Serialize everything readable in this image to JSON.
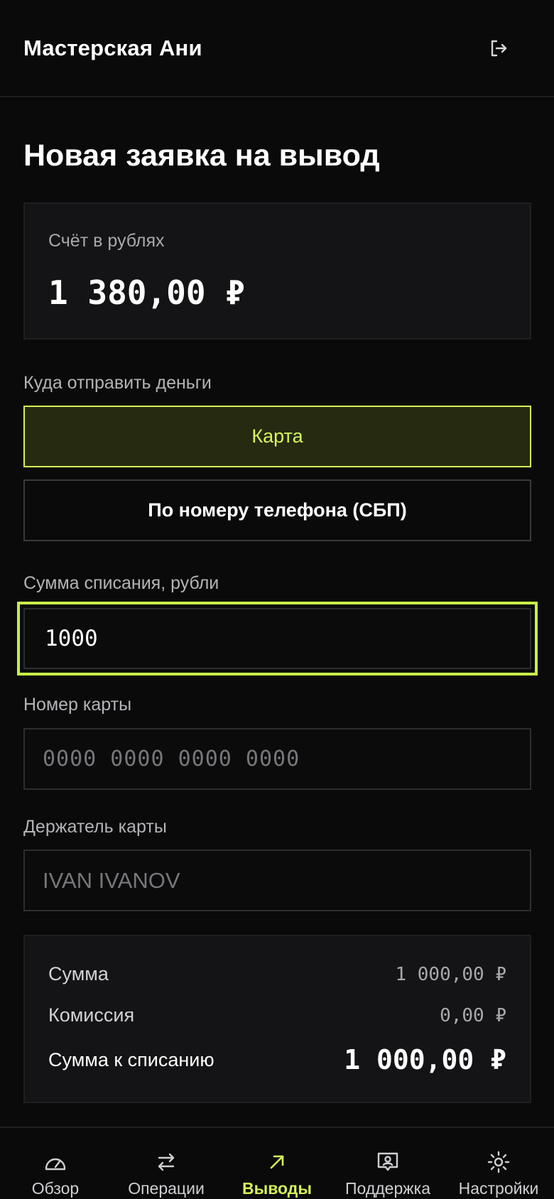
{
  "header": {
    "title": "Мастерская Ани",
    "logout_icon": "logout-icon"
  },
  "page": {
    "title": "Новая заявка на вывод"
  },
  "balance": {
    "label": "Счёт в рублях",
    "value": "1 380,00 ₽"
  },
  "destination": {
    "label": "Куда отправить деньги",
    "options": [
      {
        "label": "Карта",
        "selected": true
      },
      {
        "label": "По номеру телефона (СБП)",
        "selected": false
      }
    ]
  },
  "amount": {
    "label": "Сумма списания, рубли",
    "value": "1000"
  },
  "card_number": {
    "label": "Номер карты",
    "value": "",
    "placeholder": "0000 0000 0000 0000"
  },
  "card_holder": {
    "label": "Держатель карты",
    "value": "",
    "placeholder": "IVAN IVANOV"
  },
  "summary": {
    "sum_label": "Сумма",
    "sum_value": "1 000,00 ₽",
    "fee_label": "Комиссия",
    "fee_value": "0,00 ₽",
    "total_label": "Сумма к списанию",
    "total_value": "1 000,00 ₽"
  },
  "tabs": [
    {
      "label": "Обзор",
      "icon": "gauge-icon",
      "active": false
    },
    {
      "label": "Операции",
      "icon": "transfer-arrows-icon",
      "active": false
    },
    {
      "label": "Выводы",
      "icon": "arrow-up-right-icon",
      "active": true
    },
    {
      "label": "Поддержка",
      "icon": "chat-person-icon",
      "active": false
    },
    {
      "label": "Настройки",
      "icon": "sun-gear-icon",
      "active": false
    }
  ],
  "colors": {
    "accent": "#d4f05a",
    "background": "#0a0a0a",
    "card": "#141416"
  }
}
